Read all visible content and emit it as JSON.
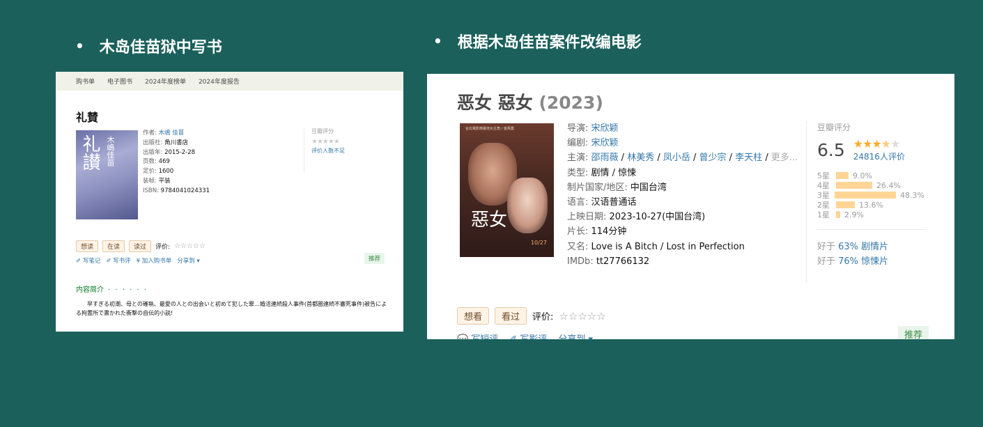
{
  "headings": {
    "left": "木岛佳苗狱中写书",
    "right": "根据木岛佳苗案件改编电影",
    "bullet": "•"
  },
  "book": {
    "nav": [
      "购书单",
      "电子图书",
      "2024年度榜单",
      "2024年度报告"
    ],
    "title": "礼賛",
    "cover": {
      "big": "礼讃",
      "small": "木嶋佳苗"
    },
    "info": [
      {
        "k": "作者:",
        "v": "木嶋 佳苗",
        "link": true
      },
      {
        "k": "出版社:",
        "v": "角川書店"
      },
      {
        "k": "出版年:",
        "v": "2015-2-28"
      },
      {
        "k": "页数:",
        "v": "469"
      },
      {
        "k": "定价:",
        "v": "1600"
      },
      {
        "k": "装帧:",
        "v": "平装"
      },
      {
        "k": "ISBN:",
        "v": "9784041024331"
      }
    ],
    "rating_title": "豆瓣评分",
    "rating_stars": "★★★★★",
    "rating_note": "评价人数不足",
    "actions": [
      "想读",
      "在读",
      "读过"
    ],
    "rate_label": "评价:",
    "rate_stars": "☆☆☆☆☆",
    "links": [
      "✐ 写笔记",
      "✐ 写书评",
      "¥ 加入购书单",
      "分享到 ▾"
    ],
    "recommend": "推荐",
    "intro_title": "内容简介",
    "intro_dots": "· · · · · ·",
    "intro_text": "早すぎる初潮、母との確執、最愛の人との出会いと初めて犯した罪…婚活連続殺人事件(首都圏連続不審死事件)被告による拘置所で書かれた衝撃の自伝的小説!"
  },
  "movie": {
    "title": "恶女 惡女",
    "year": "(2023)",
    "poster": {
      "text": "惡女",
      "top": "台北電影節最佳女主角 / 金馬獎",
      "date": "10/27"
    },
    "info": [
      {
        "k": "导演: ",
        "v": "宋欣颖",
        "link": true
      },
      {
        "k": "编剧: ",
        "v": "宋欣颖",
        "link": true
      },
      {
        "k": "类型: ",
        "v": "剧情 / 惊悚"
      },
      {
        "k": "制片国家/地区: ",
        "v": "中国台湾"
      },
      {
        "k": "语言: ",
        "v": "汉语普通话"
      },
      {
        "k": "上映日期: ",
        "v": "2023-10-27(中国台湾)"
      },
      {
        "k": "片长: ",
        "v": "114分钟"
      },
      {
        "k": "又名: ",
        "v": "Love is A Bitch / Lost in Perfection"
      },
      {
        "k": "IMDb: ",
        "v": "tt27766132"
      }
    ],
    "cast_label": "主演: ",
    "cast": [
      "邵雨薇",
      "林美秀",
      "凤小岳",
      "曾少宗",
      "李天柱"
    ],
    "cast_more": "更多...",
    "rating_title": "豆瓣评分",
    "score": "6.5",
    "stars_on": "★★★",
    "stars_half": "★",
    "stars_off": "★",
    "count": "24816人评价",
    "dist": [
      {
        "label": "5星",
        "pct": "9.0%",
        "value": 9.0
      },
      {
        "label": "4星",
        "pct": "26.4%",
        "value": 26.4
      },
      {
        "label": "3星",
        "pct": "48.3%",
        "value": 48.3
      },
      {
        "label": "2星",
        "pct": "13.6%",
        "value": 13.6
      },
      {
        "label": "1星",
        "pct": "2.9%",
        "value": 2.9
      }
    ],
    "better": [
      {
        "pre": "好于 ",
        "v": "63% 剧情片"
      },
      {
        "pre": "好于 ",
        "v": "76% 惊悚片"
      }
    ],
    "actions": [
      "想看",
      "看过"
    ],
    "rate_label": "评价:",
    "rate_stars": "☆☆☆☆☆",
    "links": [
      "💬 写短评",
      "✐ 写影评",
      "分享到 ▾"
    ],
    "recommend": "推荐"
  }
}
